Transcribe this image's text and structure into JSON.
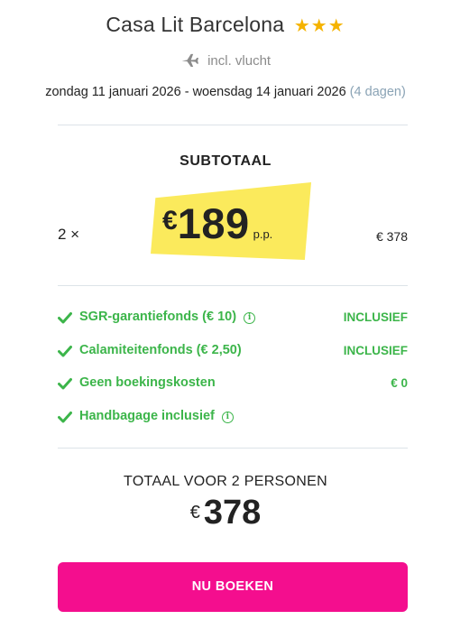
{
  "hotel": {
    "name": "Casa Lit Barcelona",
    "stars": "★★★",
    "flight_note": "incl. vlucht"
  },
  "trip": {
    "dates": "zondag 11 januari 2026 - woensdag 14 januari 2026",
    "duration": "(4 dagen)"
  },
  "subtotal": {
    "label": "SUBTOTAAL",
    "quantity": "2 ×",
    "currency": "€",
    "price_per_person": "189",
    "pp_label": "p.p.",
    "line_total": "€ 378"
  },
  "features": [
    {
      "label": "SGR-garantiefonds  (€ 10)",
      "info_icon": true,
      "status": "INCLUSIEF"
    },
    {
      "label": "Calamiteitenfonds  (€ 2,50)",
      "info_icon": false,
      "status": "INCLUSIEF"
    },
    {
      "label": "Geen boekingskosten",
      "info_icon": false,
      "status": "€ 0"
    },
    {
      "label": "Handbagage inclusief",
      "info_icon": true,
      "status": ""
    }
  ],
  "total": {
    "label": "TOTAAL VOOR 2 PERSONEN",
    "currency": "€",
    "amount": "378"
  },
  "cta": {
    "label": "NU BOEKEN"
  },
  "colors": {
    "star": "#f5b300",
    "highlight": "#fbe84a",
    "green": "#3cb54a",
    "cta": "#f40e8e"
  },
  "icons": {
    "flight": "airplane-icon",
    "check": "check-icon",
    "info": "info-icon"
  }
}
